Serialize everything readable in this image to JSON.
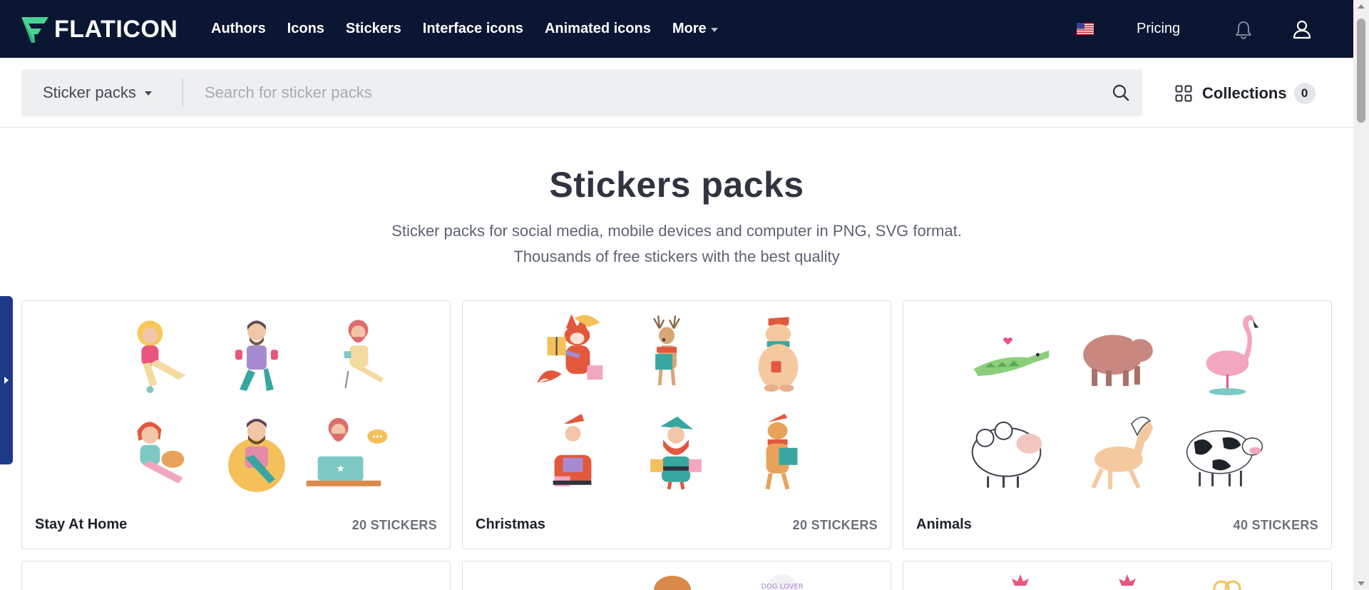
{
  "header": {
    "logo_text": "FLATICON",
    "nav": [
      {
        "label": "Authors"
      },
      {
        "label": "Icons"
      },
      {
        "label": "Stickers"
      },
      {
        "label": "Interface icons"
      },
      {
        "label": "Animated icons"
      },
      {
        "label": "More"
      }
    ],
    "pricing_label": "Pricing",
    "colors": {
      "background": "#0b1632",
      "logo_accent": "#4ad295"
    }
  },
  "search": {
    "type_label": "Sticker packs",
    "placeholder": "Search for sticker packs",
    "value": "",
    "collections_label": "Collections",
    "collections_count": "0"
  },
  "page": {
    "title": "Stickers packs",
    "subtitle_line1": "Sticker packs for social media, mobile devices and computer in PNG, SVG format.",
    "subtitle_line2": "Thousands of free stickers with the best quality"
  },
  "packs": [
    {
      "name": "Stay At Home",
      "count": "20 STICKERS",
      "icons": [
        "exercise-sticker",
        "dumbbell-sticker",
        "coffee-sticker",
        "cat-sticker",
        "reading-sticker",
        "laptop-sticker"
      ]
    },
    {
      "name": "Christmas",
      "count": "20 STICKERS",
      "icons": [
        "fox-sticker",
        "reindeer-sticker",
        "bear-sticker",
        "santa-sticker",
        "elf-sticker",
        "tiger-sticker"
      ]
    },
    {
      "name": "Animals",
      "count": "40 STICKERS",
      "icons": [
        "crocodile-sticker",
        "bison-sticker",
        "flamingo-sticker",
        "sheep-sticker",
        "horse-sticker",
        "cow-sticker"
      ]
    }
  ]
}
